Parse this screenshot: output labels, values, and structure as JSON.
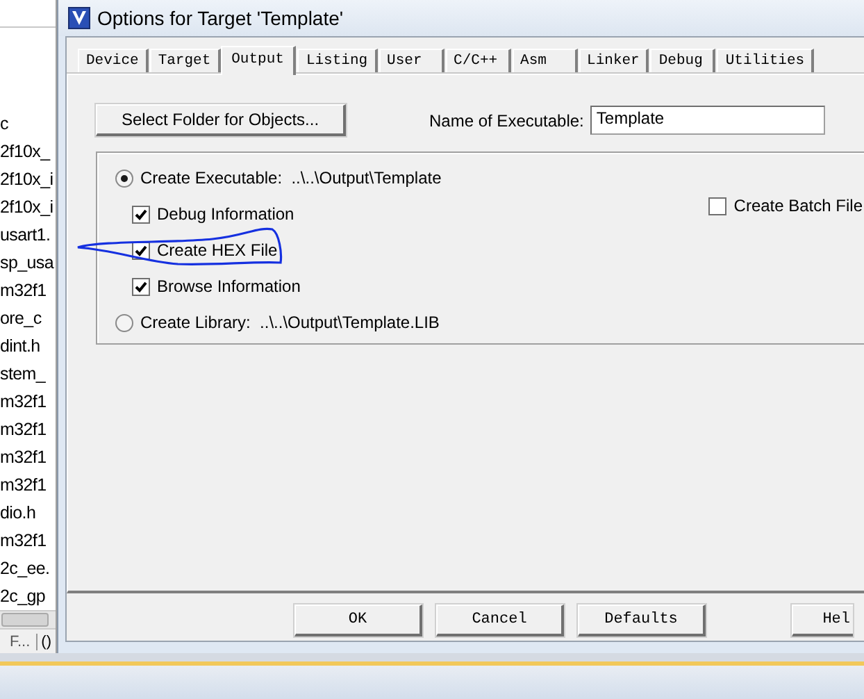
{
  "window": {
    "title": "Options for Target 'Template'"
  },
  "file_list": {
    "items": [
      "c",
      "2f10x_",
      "2f10x_i",
      "2f10x_i",
      "usart1.",
      "sp_usa",
      "m32f1",
      "ore_c",
      "dint.h",
      "stem_",
      "m32f1",
      "m32f1",
      "m32f1",
      "m32f1",
      "dio.h",
      "m32f1",
      "2c_ee.",
      "2c_gp"
    ]
  },
  "status_bar": {
    "items": [
      "F...",
      "()"
    ]
  },
  "tabs": [
    {
      "label": "Device",
      "selected": false
    },
    {
      "label": "Target",
      "selected": false
    },
    {
      "label": "Output",
      "selected": true
    },
    {
      "label": "Listing",
      "selected": false
    },
    {
      "label": "User",
      "selected": false
    },
    {
      "label": "C/C++",
      "selected": false
    },
    {
      "label": "Asm",
      "selected": false
    },
    {
      "label": "Linker",
      "selected": false
    },
    {
      "label": "Debug",
      "selected": false
    },
    {
      "label": "Utilities",
      "selected": false
    }
  ],
  "output": {
    "select_folder_button": "Select Folder for Objects...",
    "executable_name": {
      "label": "Name of Executable:",
      "value": "Template"
    },
    "options": [
      {
        "kind": "radio",
        "label": "Create Executable:  ..\\..\\Output\\Template",
        "selected": true
      },
      {
        "kind": "checkbox",
        "label": "Debug Information",
        "checked": true
      },
      {
        "kind": "checkbox",
        "label": "Create HEX File",
        "checked": true
      },
      {
        "kind": "checkbox",
        "label": "Browse Information",
        "checked": true
      },
      {
        "kind": "radio",
        "label": "Create Library:  ..\\..\\Output\\Template.LIB",
        "selected": false
      }
    ],
    "batch_file": {
      "label": "Create Batch File",
      "checked": false
    }
  },
  "buttons": [
    {
      "label": "OK"
    },
    {
      "label": "Cancel"
    },
    {
      "label": "Defaults"
    },
    {
      "label": "Hel"
    }
  ]
}
